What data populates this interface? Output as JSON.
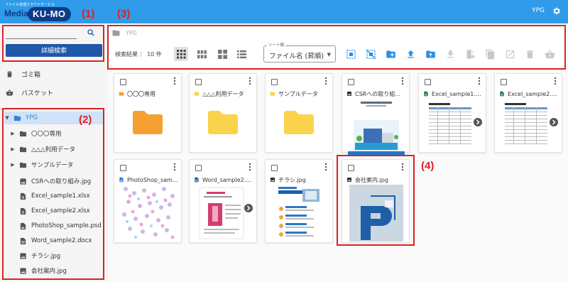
{
  "header": {
    "tagline": "ファイル管理クラウドサービス",
    "brand_prefix": "Media",
    "brand_badge": "KU-MO",
    "user": "YPG"
  },
  "sidebar": {
    "search_placeholder": "",
    "advanced_search": "詳細検索",
    "links": [
      {
        "label": "ゴミ箱",
        "icon": "trash-icon"
      },
      {
        "label": "バスケット",
        "icon": "basket-icon"
      }
    ],
    "tree": [
      {
        "label": "YPG",
        "icon": "folder-icon",
        "arrow": "▼",
        "selected": true
      },
      {
        "label": "〇〇〇専用",
        "icon": "folder-icon",
        "arrow": "▶"
      },
      {
        "label": "△△△利用データ",
        "icon": "folder-icon",
        "arrow": "▶"
      },
      {
        "label": "サンプルデータ",
        "icon": "folder-icon",
        "arrow": "▶"
      },
      {
        "label": "CSRへの取り組み.jpg",
        "icon": "image-file-icon",
        "arrow": ""
      },
      {
        "label": "Excel_sample1.xlsx",
        "icon": "excel-file-icon",
        "arrow": ""
      },
      {
        "label": "Excel_sample2.xlsx",
        "icon": "excel-file-icon",
        "arrow": ""
      },
      {
        "label": "PhotoShop_sample.psd",
        "icon": "psd-file-icon",
        "arrow": ""
      },
      {
        "label": "Word_sample2.docx",
        "icon": "word-file-icon",
        "arrow": ""
      },
      {
        "label": "チラシ.jpg",
        "icon": "image-file-icon",
        "arrow": ""
      },
      {
        "label": "会社案内.jpg",
        "icon": "image-file-icon",
        "arrow": ""
      }
    ]
  },
  "toolbar": {
    "breadcrumb": "YPG",
    "result_text": "検索結果 ： 10 件",
    "sort_label": "ソート順",
    "sort_value": "ファイル名 (昇順)",
    "view_icons": [
      "grid-small-icon",
      "grid-medium-icon",
      "grid-large-icon",
      "list-icon"
    ],
    "action_icons": [
      "select-all-icon",
      "deselect-icon",
      "new-folder-icon",
      "upload-icon",
      "upload-folder-icon",
      "download-icon",
      "move-icon",
      "copy-icon",
      "edit-icon",
      "delete-icon",
      "basket-add-icon"
    ]
  },
  "files": [
    {
      "name": "〇〇〇専用",
      "type": "folder"
    },
    {
      "name": "△△△利用データ",
      "type": "folder"
    },
    {
      "name": "サンプルデータ",
      "type": "folder"
    },
    {
      "name": "CSRへの取り組み.jpg",
      "type": "image"
    },
    {
      "name": "Excel_sample1.xlsx",
      "type": "excel"
    },
    {
      "name": "Excel_sample2.xlsx",
      "type": "excel"
    },
    {
      "name": "PhotoShop_sample.psd",
      "type": "psd"
    },
    {
      "name": "Word_sample2.docx",
      "type": "word"
    },
    {
      "name": "チラシ.jpg",
      "type": "image"
    },
    {
      "name": "会社案内.jpg",
      "type": "image"
    }
  ],
  "annotations": [
    "(1)",
    "(2)",
    "(3)",
    "(4)"
  ],
  "colors": {
    "header": "#2f9be9",
    "brand_navy": "#0d3b87",
    "action_blue": "#2b8ee6",
    "annotation_red": "#e02020",
    "folder_orange": "#f6a030",
    "folder_yellow": "#fad34a"
  }
}
